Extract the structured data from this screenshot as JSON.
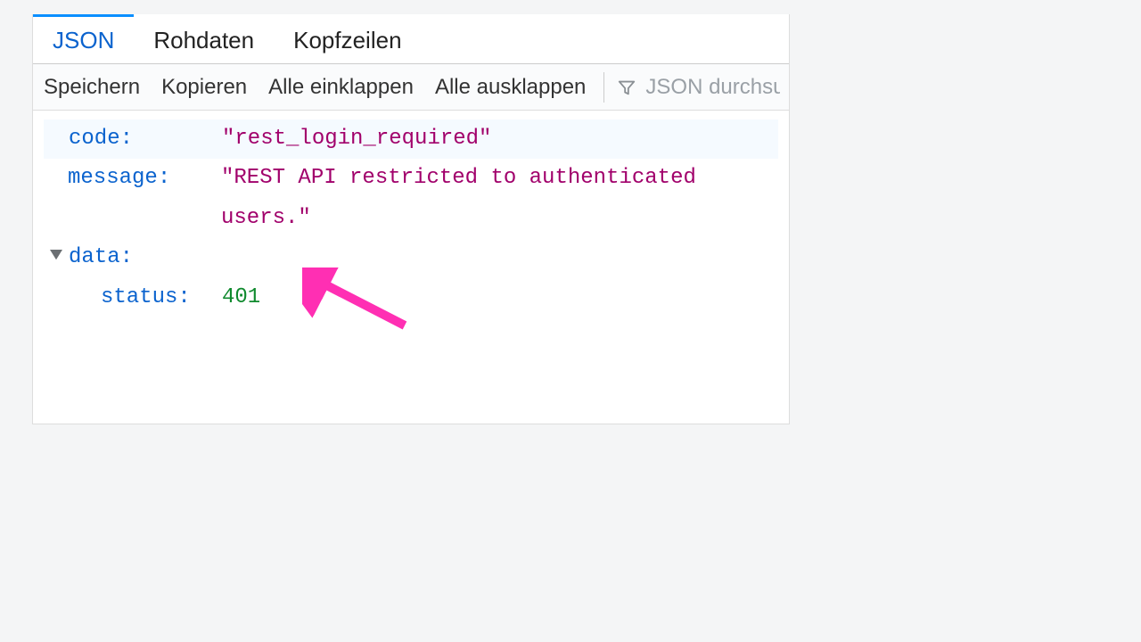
{
  "tabs": {
    "json": "JSON",
    "raw": "Rohdaten",
    "headers": "Kopfzeilen"
  },
  "toolbar": {
    "save": "Speichern",
    "copy": "Kopieren",
    "collapse_all": "Alle einklappen",
    "expand_all": "Alle ausklappen",
    "search_placeholder": "JSON durchsuchen"
  },
  "json": {
    "code_key": "code:",
    "code_val": "\"rest_login_required\"",
    "message_key": "message:",
    "message_val": "\"REST API restricted to authenticated users.\"",
    "data_key": "data:",
    "status_key": "status:",
    "status_val": "401"
  }
}
